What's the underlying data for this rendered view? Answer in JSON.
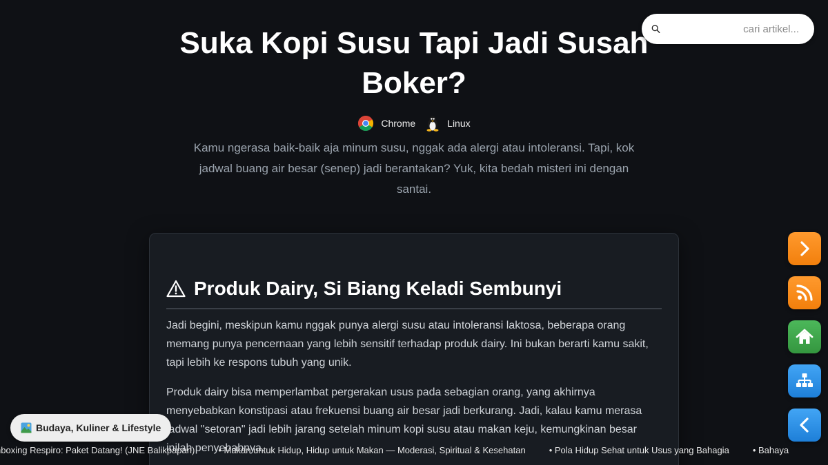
{
  "search": {
    "placeholder": "cari artikel..."
  },
  "header": {
    "title": "Suka Kopi Susu Tapi Jadi Susah Boker?",
    "environment": [
      {
        "icon": "chrome-icon",
        "label": "Chrome"
      },
      {
        "icon": "linux-tux-icon",
        "label": "Linux"
      }
    ],
    "lead": "Kamu ngerasa baik-baik aja minum susu, nggak ada alergi atau intoleransi. Tapi, kok jadwal buang air besar (senep) jadi berantakan? Yuk, kita bedah misteri ini dengan santai."
  },
  "article": {
    "section_icon": "warning-triangle-icon",
    "section_title": "Produk Dairy, Si Biang Keladi Sembunyi",
    "paragraphs": [
      "Jadi begini, meskipun kamu nggak punya alergi susu atau intoleransi laktosa, beberapa orang memang punya pencernaan yang lebih sensitif terhadap produk dairy. Ini bukan berarti kamu sakit, tapi lebih ke respons tubuh yang unik.",
      "Produk dairy bisa memperlambat pergerakan usus pada sebagian orang, yang akhirnya menyebabkan konstipasi atau frekuensi buang air besar jadi berkurang. Jadi, kalau kamu merasa jadwal \"setoran\" jadi lebih jarang setelah minum kopi susu atau makan keju, kemungkinan besar inilah penyebabnya."
    ]
  },
  "side_nav": [
    {
      "icon": "chevron-right-icon",
      "color": "#f5890f"
    },
    {
      "icon": "rss-icon",
      "color": "#f5890f"
    },
    {
      "icon": "home-icon",
      "color": "#3fa84b"
    },
    {
      "icon": "sitemap-icon",
      "color": "#2e8fe6"
    },
    {
      "icon": "chevron-left-icon",
      "color": "#2e8fe6"
    }
  ],
  "category": {
    "icon": "landscape-picture-icon",
    "label": "Budaya, Kuliner & Lifestyle"
  },
  "ticker": [
    "nboxing Respiro: Paket Datang! (JNE Balikpapan)",
    "• Makan untuk Hidup, Hidup untuk Makan — Moderasi, Spiritual & Kesehatan",
    "• Pola Hidup Sehat untuk Usus yang Bahagia",
    "• Bahaya"
  ]
}
